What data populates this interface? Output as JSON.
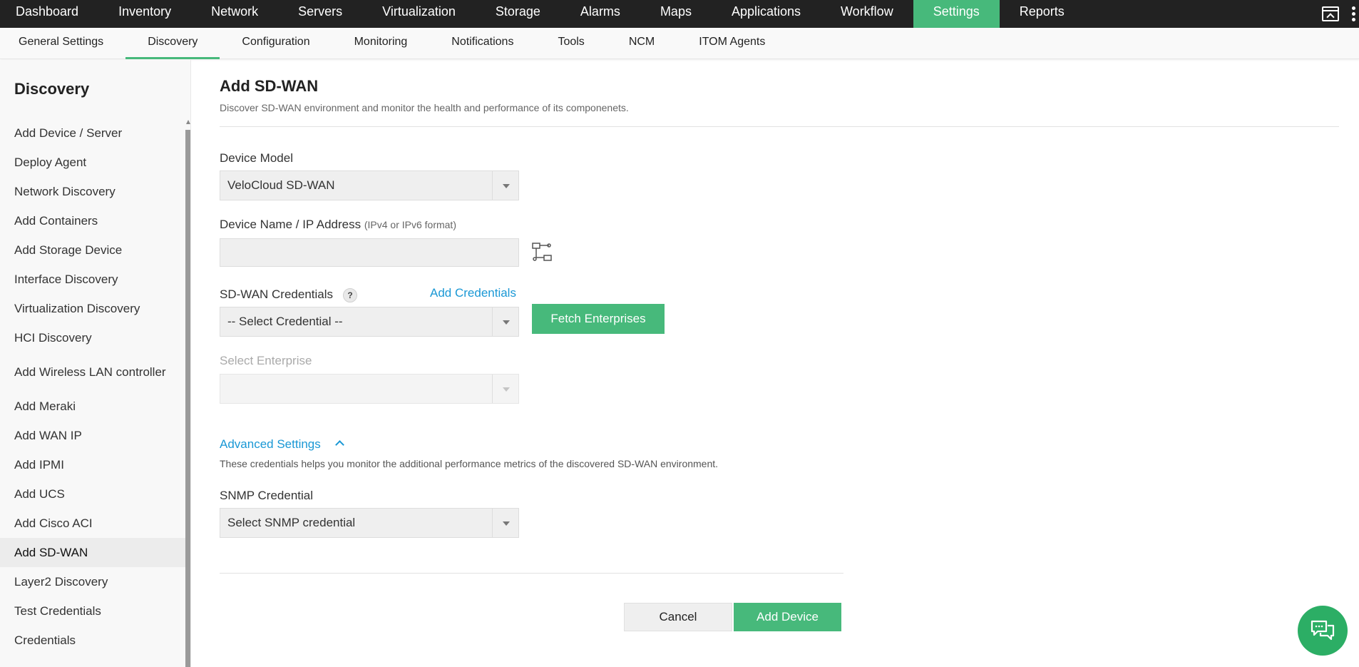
{
  "topnav": {
    "items": [
      "Dashboard",
      "Inventory",
      "Network",
      "Servers",
      "Virtualization",
      "Storage",
      "Alarms",
      "Maps",
      "Applications",
      "Workflow",
      "Settings",
      "Reports"
    ],
    "active_index": 10,
    "right_icons": [
      "window-icon",
      "kebab-menu-icon"
    ]
  },
  "subnav": {
    "items": [
      "General Settings",
      "Discovery",
      "Configuration",
      "Monitoring",
      "Notifications",
      "Tools",
      "NCM",
      "ITOM Agents"
    ],
    "active_index": 1
  },
  "sidebar": {
    "title": "Discovery",
    "items": [
      {
        "label": "Add Device / Server"
      },
      {
        "label": "Deploy Agent"
      },
      {
        "label": "Network Discovery"
      },
      {
        "label": "Add Containers"
      },
      {
        "label": "Add Storage Device"
      },
      {
        "label": "Interface Discovery"
      },
      {
        "label": "Virtualization Discovery"
      },
      {
        "label": "HCI Discovery"
      },
      {
        "label": "Add Wireless LAN controller"
      },
      {
        "label": "Add Meraki"
      },
      {
        "label": "Add WAN IP"
      },
      {
        "label": "Add IPMI"
      },
      {
        "label": "Add UCS"
      },
      {
        "label": "Add Cisco ACI"
      },
      {
        "label": "Add SD-WAN"
      },
      {
        "label": "Layer2 Discovery"
      },
      {
        "label": "Test Credentials"
      },
      {
        "label": "Credentials"
      }
    ],
    "active_index": 14
  },
  "main": {
    "title": "Add SD-WAN",
    "description": "Discover SD-WAN environment and monitor the health and performance of its componenets.",
    "device_model": {
      "label": "Device Model",
      "value": "VeloCloud SD-WAN"
    },
    "device_name": {
      "label": "Device Name / IP Address",
      "hint": "(IPv4 or IPv6 format)",
      "value": ""
    },
    "credentials": {
      "label": "SD-WAN Credentials",
      "help": "?",
      "add_link": "Add Credentials",
      "value": "-- Select Credential --",
      "fetch_button": "Fetch Enterprises"
    },
    "enterprise": {
      "label": "Select Enterprise",
      "value": ""
    },
    "advanced": {
      "toggle_label": "Advanced Settings",
      "description": "These credentials helps you monitor the additional performance metrics of the discovered SD-WAN environment.",
      "snmp_label": "SNMP Credential",
      "snmp_value": "Select SNMP credential"
    },
    "actions": {
      "cancel": "Cancel",
      "submit": "Add Device"
    }
  },
  "colors": {
    "accent_green": "#47b97b",
    "link_blue": "#1a98d5",
    "topbar_bg": "#222222",
    "chat_green": "#2cae65"
  }
}
